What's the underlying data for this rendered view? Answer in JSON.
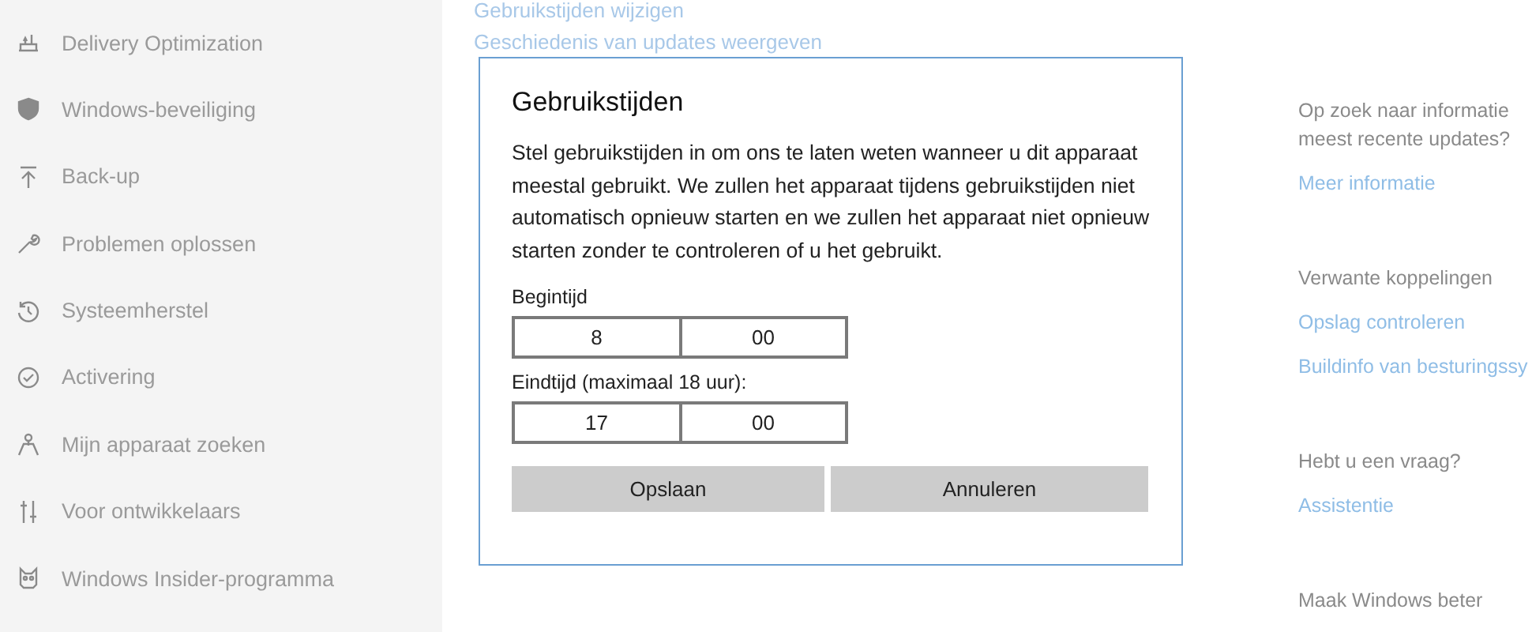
{
  "sidebar": {
    "items": [
      {
        "label": "Delivery Optimization"
      },
      {
        "label": "Windows-beveiliging"
      },
      {
        "label": "Back-up"
      },
      {
        "label": "Problemen oplossen"
      },
      {
        "label": "Systeemherstel"
      },
      {
        "label": "Activering"
      },
      {
        "label": "Mijn apparaat zoeken"
      },
      {
        "label": "Voor ontwikkelaars"
      },
      {
        "label": "Windows Insider-programma"
      }
    ]
  },
  "main": {
    "links": [
      "Gebruikstijden wijzigen",
      "Geschiedenis van updates weergeven"
    ]
  },
  "right": {
    "sections": [
      {
        "lines": [
          "Op zoek naar informatie",
          "meest recente updates?"
        ],
        "links": [
          "Meer informatie"
        ]
      },
      {
        "lines": [
          "Verwante koppelingen"
        ],
        "links": [
          "Opslag controleren",
          "Buildinfo van besturingssy"
        ]
      },
      {
        "lines": [
          "Hebt u een vraag?"
        ],
        "links": [
          "Assistentie"
        ]
      },
      {
        "lines": [
          "Maak Windows beter"
        ]
      }
    ]
  },
  "dialog": {
    "title": "Gebruikstijden",
    "text": "Stel gebruikstijden in om ons te laten weten wanneer u dit apparaat meestal gebruikt. We zullen het apparaat tijdens gebruikstijden niet automatisch opnieuw starten en we zullen het apparaat niet opnieuw starten zonder te controleren of u het gebruikt.",
    "fields": [
      {
        "label": "Begintijd",
        "hour": "8",
        "minute": "00"
      },
      {
        "label": "Eindtijd (maximaal 18 uur):",
        "hour": "17",
        "minute": "00"
      }
    ],
    "buttons": [
      "Opslaan",
      "Annuleren"
    ]
  }
}
